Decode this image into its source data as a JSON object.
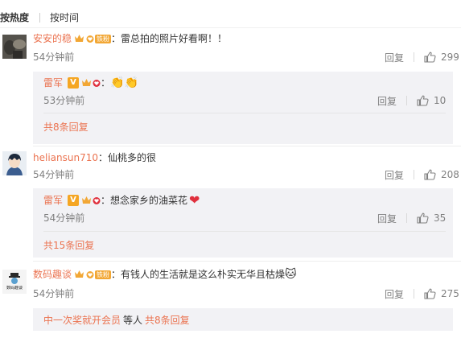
{
  "sort": {
    "hot_label": "按热度",
    "time_label": "按时间"
  },
  "comments": [
    {
      "username": "安安的稳",
      "fan_badge": "铁粉",
      "text": "：雷总拍的照片好看啊！！",
      "time": "54分钟前",
      "reply_label": "回复",
      "likes": "299",
      "sub_reply": {
        "username": "雷军",
        "v_badge": "V",
        "text": "：",
        "emoji": "👏👏",
        "time": "53分钟前",
        "reply_label": "回复",
        "likes": "10"
      },
      "more_replies": "共8条回复"
    },
    {
      "username": "heliansun710",
      "text": "：仙桃多的很",
      "time": "54分钟前",
      "reply_label": "回复",
      "likes": "208",
      "sub_reply": {
        "username": "雷军",
        "v_badge": "V",
        "text": "：想念家乡的油菜花",
        "emoji": "❤",
        "time": "54分钟前",
        "reply_label": "回复",
        "likes": "35"
      },
      "more_replies": "共15条回复"
    },
    {
      "username": "数码趣谈",
      "fan_badge": "铁粉",
      "text": "：有钱人的生活就是这么朴实无华且枯燥",
      "emoji": "🐱",
      "avatar_text": "数码趣谈",
      "time": "54分钟前",
      "reply_label": "回复",
      "likes": "275",
      "footer": {
        "replier": "中一次奖就开会员",
        "middle": "等人",
        "count": "共8条回复"
      }
    }
  ],
  "colors": {
    "link": "#eb7350",
    "fan_badge": "#f2a735",
    "v_badge": "#f5a623",
    "heart": "#e0303d",
    "reply_bg": "#f2f2f5"
  }
}
